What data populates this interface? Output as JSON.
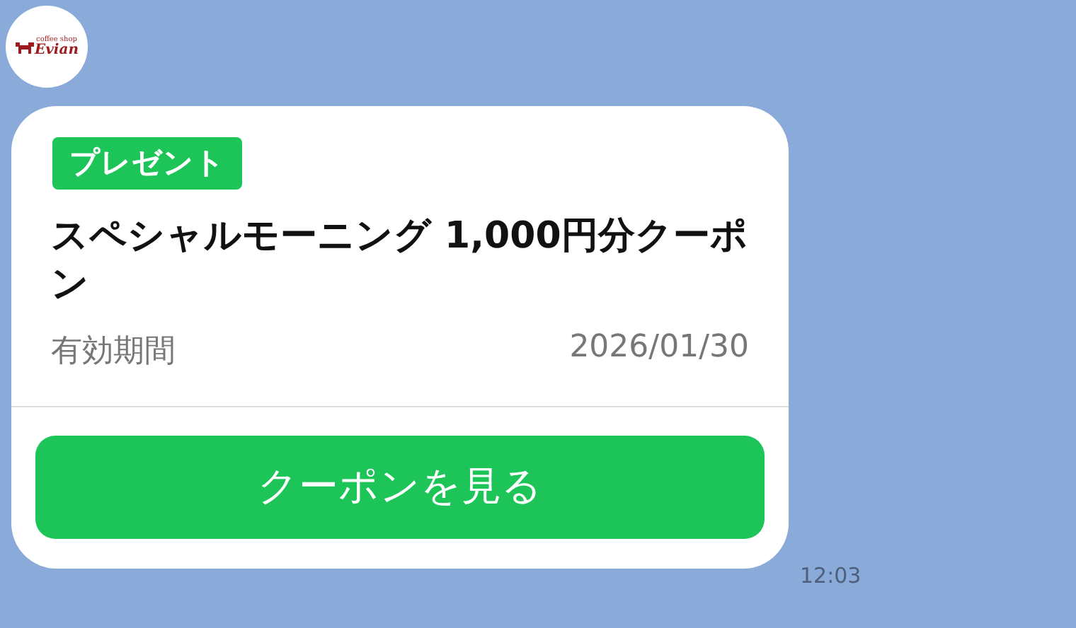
{
  "chat": {
    "sender": {
      "logo_small_text": "coffee shop",
      "logo_name": "Evian"
    },
    "message": {
      "badge": "プレゼント",
      "title": "スペシャルモーニング 1,000円分クーポン",
      "validity_label": "有効期間",
      "validity_date": "2026/01/30",
      "button": "クーポンを見る",
      "time": "12:03"
    }
  }
}
